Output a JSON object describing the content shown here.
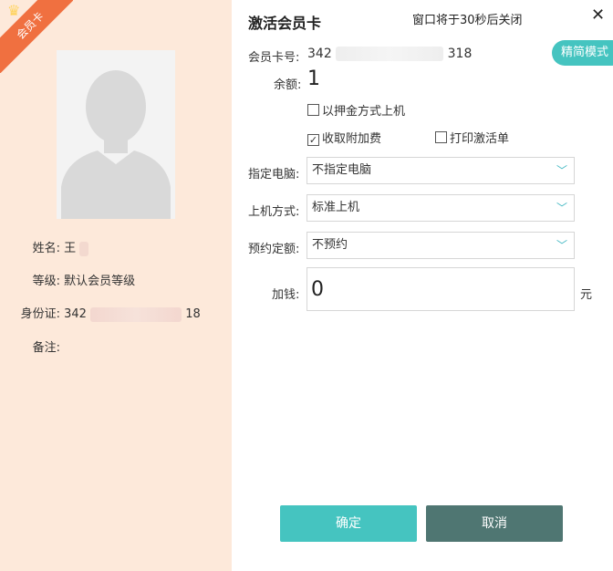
{
  "card_badge": "会员卡",
  "member": {
    "name_label": "姓名:",
    "name": "王",
    "level_label": "等级:",
    "level": "默认会员等级",
    "id_label": "身份证:",
    "id_prefix": "342",
    "id_suffix": "18",
    "remark_label": "备注:",
    "remark": ""
  },
  "dialog": {
    "title": "激活会员卡",
    "countdown": "窗口将于30秒后关闭",
    "close": "✕",
    "mode_button": "精简模式"
  },
  "form": {
    "card_no_label": "会员卡号:",
    "card_no_prefix": "342",
    "card_no_suffix": "318",
    "balance_label": "余额:",
    "balance": "1",
    "deposit_login_label": "以押金方式上机",
    "deposit_login_checked": false,
    "surcharge_label": "收取附加费",
    "surcharge_checked": true,
    "print_receipt_label": "打印激活单",
    "print_receipt_checked": false,
    "computer_label": "指定电脑:",
    "computer_value": "不指定电脑",
    "login_mode_label": "上机方式:",
    "login_mode_value": "标准上机",
    "booking_label": "预约定额:",
    "booking_value": "不预约",
    "topup_label": "加钱:",
    "topup_value": "0",
    "unit": "元"
  },
  "buttons": {
    "confirm": "确定",
    "cancel": "取消"
  },
  "colors": {
    "accent": "#45c4c0",
    "cancel": "#4f7672",
    "left_panel": "#fde9da",
    "badge": "#f07040"
  }
}
